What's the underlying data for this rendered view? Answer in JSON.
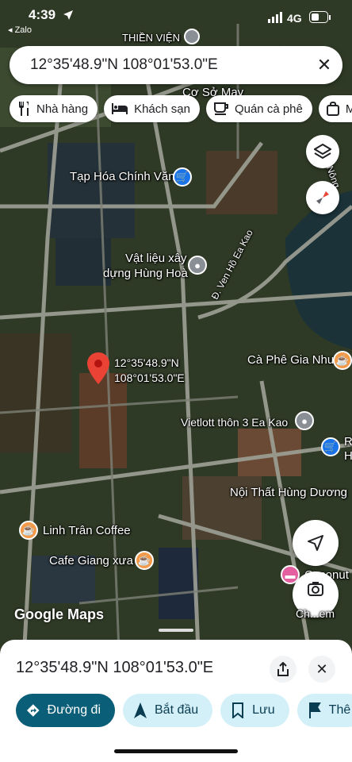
{
  "status_bar": {
    "time": "4:39",
    "back_app": "◂ Zalo",
    "network": "4G"
  },
  "search": {
    "query": "12°35'48.9\"N 108°01'53.0\"E",
    "close_icon": "close-icon"
  },
  "chips": [
    {
      "label": "Nhà hàng",
      "icon": "restaurant-icon"
    },
    {
      "label": "Khách sạn",
      "icon": "hotel-icon"
    },
    {
      "label": "Quán cà phê",
      "icon": "cafe-icon"
    },
    {
      "label": "M",
      "icon": "shopping-icon"
    }
  ],
  "map": {
    "labels": {
      "thien_vien": "THIỀN VIỆN",
      "co_so_may": "Cơ Sở May",
      "tap_hoa": "Tạp Hóa Chính Văn",
      "vat_lieu_1": "Vật liệu xây",
      "vat_lieu_2": "dựng Hùng Hoà",
      "pin_1": "12°35'48.9\"N",
      "pin_2": "108°01'53.0\"E",
      "road": "Đ. Ven Hồ Ea Kao",
      "road_side": "Kỳ Nông",
      "ca_phe": "Cà Phê Gia Như",
      "vietlott": "Vietlott thôn 3 Ea Kao",
      "noi_that": "Nội Thất Hùng Dương",
      "linh_tran": "Linh Trân Coffee",
      "giang_xua": "Cafe Giang xưa",
      "coconut": "Coconut",
      "right_r": "R",
      "right_h": "H"
    },
    "logo": "Google Maps",
    "lens_label": "Ch...em"
  },
  "sheet": {
    "title": "12°35'48.9\"N 108°01'53.0\"E",
    "actions": [
      {
        "label": "Đường đi",
        "icon": "directions-icon"
      },
      {
        "label": "Bắt đầu",
        "icon": "navigation-icon"
      },
      {
        "label": "Lưu",
        "icon": "bookmark-icon"
      },
      {
        "label": "Thê",
        "icon": "flag-icon"
      }
    ]
  },
  "colors": {
    "accent": "#0b5e77",
    "secondary_btn": "#d3f0f8",
    "pin": "#ea4335",
    "poi_blue": "#1a73e8",
    "poi_orange": "#f2994a"
  }
}
